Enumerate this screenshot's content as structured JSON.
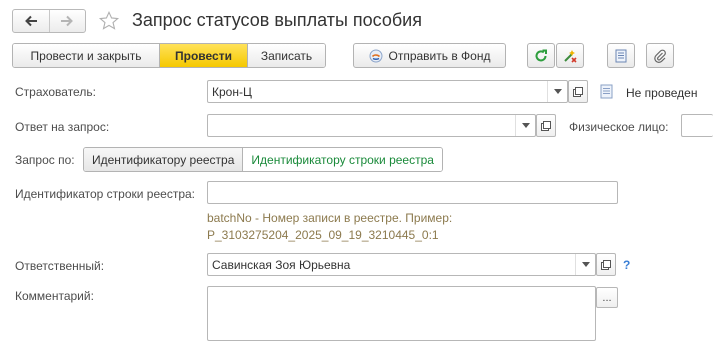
{
  "window": {
    "title": "Запрос статусов выплаты пособия"
  },
  "toolbar": {
    "post_and_close": "Провести и закрыть",
    "post": "Провести",
    "save": "Записать",
    "send_to_fund": "Отправить в Фонд"
  },
  "form": {
    "insurer_label": "Страхователь:",
    "insurer_value": "Крон-Ц",
    "status_text": "Не проведен",
    "response_label": "Ответ на запрос:",
    "response_value": "",
    "person_label": "Физическое лицо:",
    "request_by_label": "Запрос по:",
    "request_by_options": [
      "Идентификатору реестра",
      "Идентификатору строки реестра"
    ],
    "request_by_selected": "Идентификатору строки реестра",
    "registry_row_id_label": "Идентификатор строки реестра:",
    "registry_row_id_value": "",
    "hint_line1": "batchNo - Номер записи в реестре. Пример:",
    "hint_line2": "P_3103275204_2025_09_19_3210445_0:1",
    "responsible_label": "Ответственный:",
    "responsible_value": "Савинская Зоя Юрьевна",
    "help_mark": "?",
    "comment_label": "Комментарий:",
    "comment_value": "",
    "ellipsis": "..."
  },
  "colors": {
    "primary_button": "#f5c800",
    "selected_option_text": "#1a8a3a",
    "hint_text": "#8c7a4e",
    "help_mark": "#3a7fd5"
  }
}
